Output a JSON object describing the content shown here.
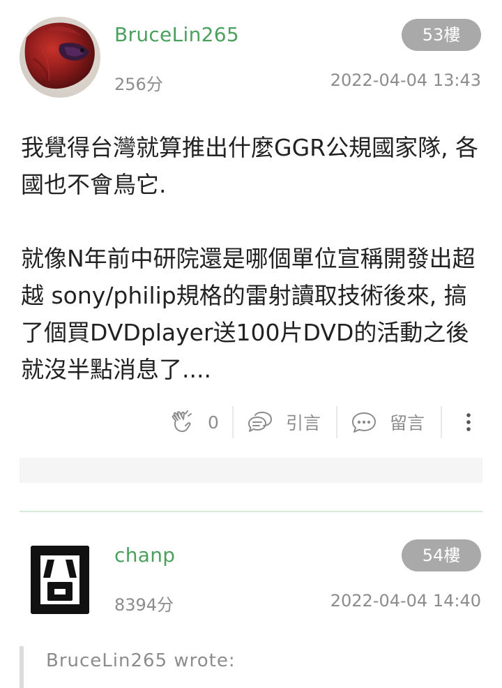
{
  "posts": [
    {
      "username": "BruceLin265",
      "score": "256分",
      "floor": "53樓",
      "timestamp": "2022-04-04 13:43",
      "avatar": "betta-fish-photo",
      "body": [
        "我覺得台灣就算推出什麼GGR公規國家隊, 各國也不會鳥它.",
        "就像N年前中研院還是哪個單位宣稱開發出超越 sony/philip規格的雷射讀取技術後來, 搞了個買DVDplayer送100片DVD的活動之後就沒半點消息了...."
      ],
      "actions": {
        "like_count": "0",
        "quote_label": "引言",
        "comment_label": "留言"
      }
    },
    {
      "username": "chanp",
      "score": "8394分",
      "floor": "54樓",
      "timestamp": "2022-04-04 14:40",
      "avatar_glyph": "囧",
      "quote_header": "BruceLin265 wrote:"
    }
  ],
  "icons": {
    "like": "clapping-hands-icon",
    "quote": "speech-bubble-icon",
    "comment": "chat-bubble-icon",
    "more": "more-vertical-icon"
  },
  "colors": {
    "username": "#4aa05c",
    "badge": "#a9a9a9",
    "meta": "#8c8c8c",
    "divider": "#d3ead7"
  }
}
